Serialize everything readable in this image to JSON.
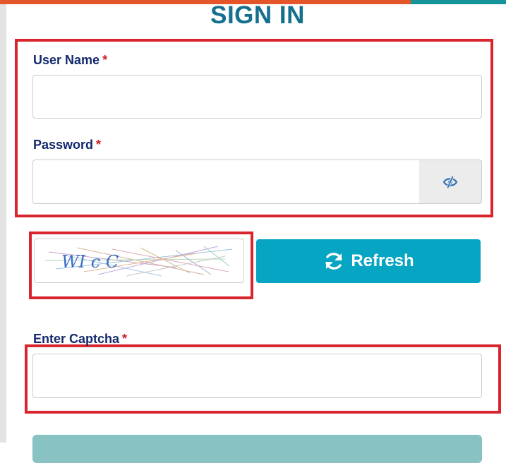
{
  "header": {
    "title": "SIGN IN"
  },
  "form": {
    "username": {
      "label": "User Name",
      "required_mark": "*",
      "value": ""
    },
    "password": {
      "label": "Password",
      "required_mark": "*",
      "value": ""
    },
    "captcha": {
      "image_text": "WI c C",
      "refresh_label": "Refresh",
      "input_label": "Enter Captcha",
      "required_mark": "*",
      "value": ""
    }
  },
  "colors": {
    "title": "#156f8f",
    "label": "#14286d",
    "required": "#d01f2a",
    "highlight_box": "#d8262e",
    "refresh_button": "#06a5c4",
    "top_bar_left": "#e4552a",
    "top_bar_right": "#17949a",
    "submit_button": "#88c2c2"
  },
  "icons": {
    "password_toggle": "eye-slash-icon",
    "refresh": "refresh-icon"
  }
}
